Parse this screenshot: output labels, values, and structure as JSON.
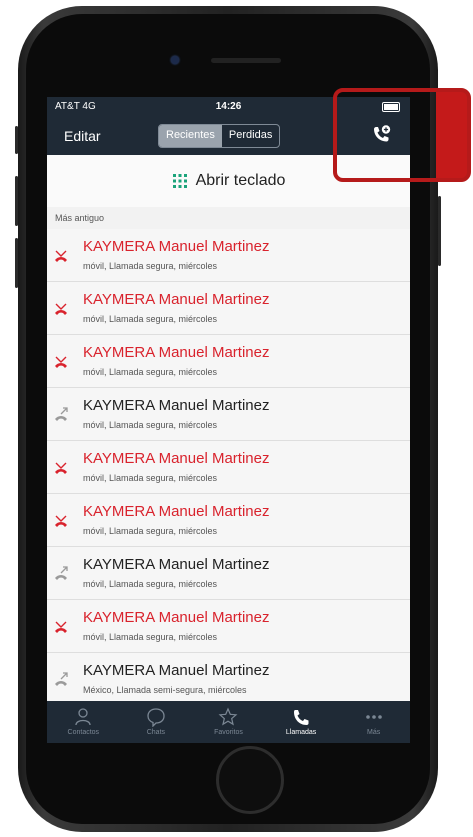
{
  "status_bar": {
    "carrier": "AT&T 4G",
    "time": "14:26"
  },
  "nav": {
    "edit_label": "Editar",
    "tabs": [
      "Recientes",
      "Perdidas"
    ],
    "active_tab": "Recientes"
  },
  "keypad": {
    "label": "Abrir teclado"
  },
  "section_label": "Más antiguo",
  "calls": [
    {
      "name": "KAYMERA Manuel  Martinez",
      "detail": "móvil, Llamada segura, miércoles",
      "missed": true
    },
    {
      "name": "KAYMERA Manuel  Martinez",
      "detail": "móvil, Llamada segura, miércoles",
      "missed": true
    },
    {
      "name": "KAYMERA Manuel  Martinez",
      "detail": "móvil, Llamada segura, miércoles",
      "missed": true
    },
    {
      "name": "KAYMERA Manuel  Martinez",
      "detail": "móvil, Llamada segura, miércoles",
      "missed": false
    },
    {
      "name": "KAYMERA Manuel  Martinez",
      "detail": "móvil, Llamada segura, miércoles",
      "missed": true
    },
    {
      "name": "KAYMERA Manuel  Martinez",
      "detail": "móvil, Llamada segura, miércoles",
      "missed": true
    },
    {
      "name": "KAYMERA Manuel  Martinez",
      "detail": "móvil, Llamada segura, miércoles",
      "missed": false
    },
    {
      "name": "KAYMERA Manuel  Martinez",
      "detail": "móvil, Llamada segura, miércoles",
      "missed": true
    },
    {
      "name": "KAYMERA Manuel  Martinez",
      "detail": "México, Llamada semi-segura, miércoles",
      "missed": false
    }
  ],
  "tabbar": [
    {
      "label": "Contactos",
      "icon": "person-icon"
    },
    {
      "label": "Chats",
      "icon": "chat-bubble-icon"
    },
    {
      "label": "Favoritos",
      "icon": "star-icon"
    },
    {
      "label": "Llamadas",
      "icon": "phone-icon"
    },
    {
      "label": "Más",
      "icon": "more-dots-icon"
    }
  ],
  "active_tabbar": "Llamadas",
  "colors": {
    "bar": "#1f2a36",
    "missed": "#d9232d",
    "highlight": "#b51a1a"
  }
}
